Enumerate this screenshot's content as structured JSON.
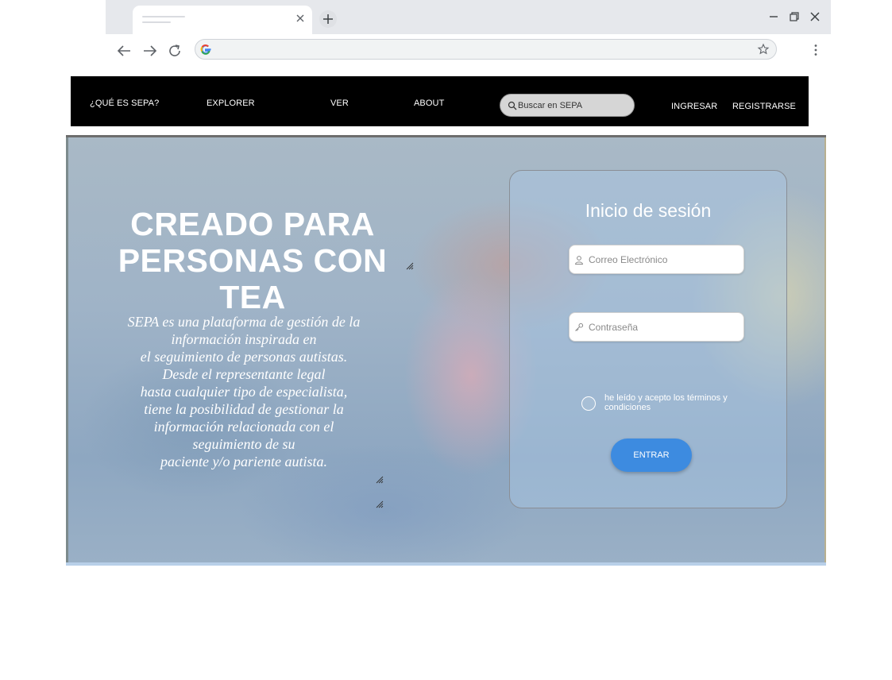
{
  "browser": {
    "icons": [
      "tab-close-icon",
      "new-tab-icon",
      "minimize-icon",
      "restore-icon",
      "window-close-icon",
      "back-icon",
      "forward-icon",
      "reload-icon",
      "google-icon",
      "star-icon",
      "more-menu-icon"
    ]
  },
  "navbar": {
    "links": [
      "¿QUÉ ES SEPA?",
      "EXPLORER",
      "VER",
      "ABOUT"
    ],
    "search_placeholder": "Buscar en SEPA",
    "login_link": "INGRESAR",
    "register_link": "REGISTRARSE"
  },
  "hero": {
    "title_lines": [
      "CREADO PARA",
      "PERSONAS CON TEA"
    ],
    "description_lines": [
      "SEPA es una plataforma de gestión de la",
      "información  inspirada en",
      "el seguimiento de personas autistas.",
      "Desde el representante legal",
      "hasta cualquier tipo de especialista,",
      "tiene la posibilidad de gestionar la",
      "información relacionada con el",
      "seguimiento de su",
      "paciente y/o pariente autista."
    ]
  },
  "login": {
    "title": "Inicio de sesión",
    "email_placeholder": "Correo Electrónico",
    "password_placeholder": "Contraseña",
    "terms_text": "he leído y acepto los términos y condiciones",
    "submit_label": "ENTRAR"
  },
  "colors": {
    "navbar_bg": "#000000",
    "button_bg": "#3d8be0",
    "text_on_hero": "#ffffff"
  }
}
